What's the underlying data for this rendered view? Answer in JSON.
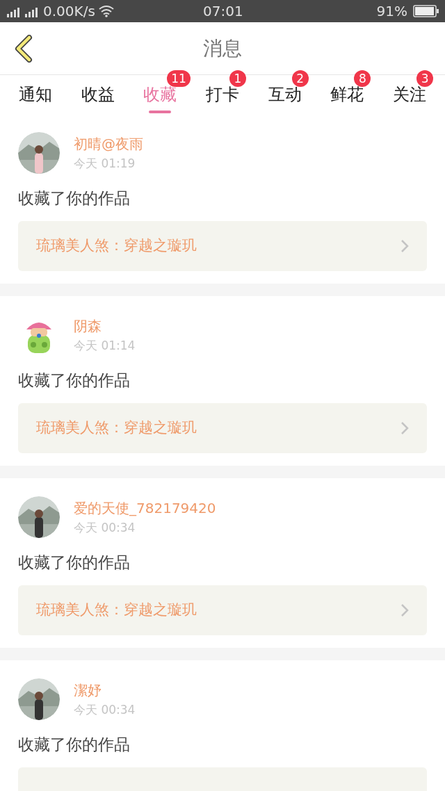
{
  "status_bar": {
    "network_speed": "0.00K/s",
    "time": "07:01",
    "battery": "91%"
  },
  "header": {
    "title": "消息"
  },
  "tabs": [
    {
      "label": "通知",
      "selected": false
    },
    {
      "label": "收益",
      "selected": false
    },
    {
      "label": "收藏",
      "selected": true,
      "badge": "11"
    },
    {
      "label": "打卡",
      "selected": false,
      "badge": "1"
    },
    {
      "label": "互动",
      "selected": false,
      "badge": "2"
    },
    {
      "label": "鲜花",
      "selected": false,
      "badge": "8"
    },
    {
      "label": "关注",
      "selected": false,
      "badge": "3"
    }
  ],
  "messages": [
    {
      "user": "初晴@夜雨",
      "time": "今天 01:19",
      "action": "收藏了你的作品",
      "work": "琉璃美人煞：穿越之璇玑"
    },
    {
      "user": "阴森",
      "time": "今天 01:14",
      "action": "收藏了你的作品",
      "work": "琉璃美人煞：穿越之璇玑"
    },
    {
      "user": "爱的天使_782179420",
      "time": "今天 00:34",
      "action": "收藏了你的作品",
      "work": "琉璃美人煞：穿越之璇玑"
    },
    {
      "user": "潔妤",
      "time": "今天 00:34",
      "action": "收藏了你的作品"
    }
  ]
}
